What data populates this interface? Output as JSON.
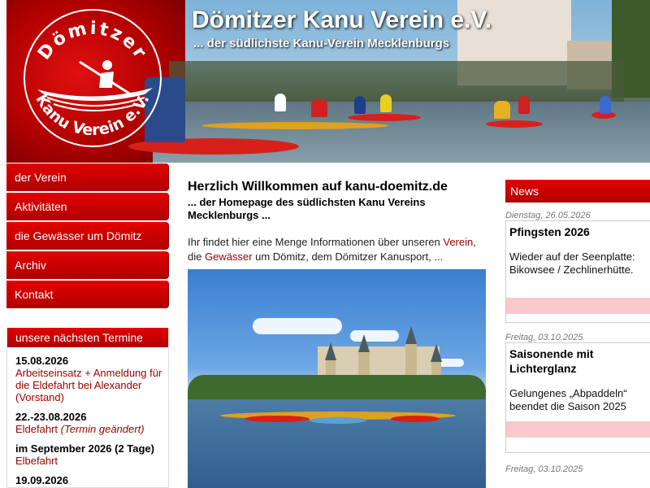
{
  "header": {
    "title": "Dömitzer Kanu Verein e.V.",
    "subtitle": "... der südlichste Kanu-Verein Mecklenburgs",
    "logo_top": "Dömitzer",
    "logo_bottom": "Kanu Verein e.V."
  },
  "nav": {
    "items": [
      {
        "label": "der Verein"
      },
      {
        "label": "Aktivitäten"
      },
      {
        "label": "die Gewässer um Dömitz"
      },
      {
        "label": "Archiv"
      },
      {
        "label": "Kontakt"
      }
    ]
  },
  "termine": {
    "heading": "unsere nächsten Termine",
    "events": [
      {
        "date": "15.08.2026",
        "text": "Arbeitseinsatz + Anmeldung für die Eldefahrt bei Alexander (Vorstand)"
      },
      {
        "date": "22.-23.08.2026",
        "text": "Eldefahrt",
        "note": "(Termin geändert)"
      },
      {
        "date": "im September 2026 (2 Tage)",
        "text": "Elbefahrt"
      },
      {
        "date": "19.09.2026",
        "text": ""
      }
    ]
  },
  "main": {
    "heading": "Herzlich Willkommen auf kanu-doemitz.de",
    "lead": "... der Homepage des südlichsten Kanu Vereins Mecklenburgs ...",
    "intro_1": "Ihr findet hier eine Menge Informationen über unseren ",
    "link_verein": "Verein",
    "intro_2": ", die ",
    "link_gewaesser": "Gewässer",
    "intro_3": " um Dömitz, dem Dömitzer Kanusport, ..."
  },
  "news": {
    "heading": "News",
    "items": [
      {
        "date": "Dienstag, 26.05.2026",
        "title": "Pfingsten 2026",
        "text": "Wieder auf der Seenplatte: Bikowsee / Zechlinerhütte."
      },
      {
        "date": "Freitag, 03.10.2025",
        "title": "Saisonende mit Lichterglanz",
        "text": "Gelungenes „Abpaddeln“ beendet die Saison 2025"
      },
      {
        "date": "Freitag, 03.10.2025",
        "title": "",
        "text": ""
      }
    ]
  },
  "colors": {
    "accent_red": "#cc0000",
    "link_red": "#a00000",
    "news_footer_pink": "#f8c8cc"
  }
}
